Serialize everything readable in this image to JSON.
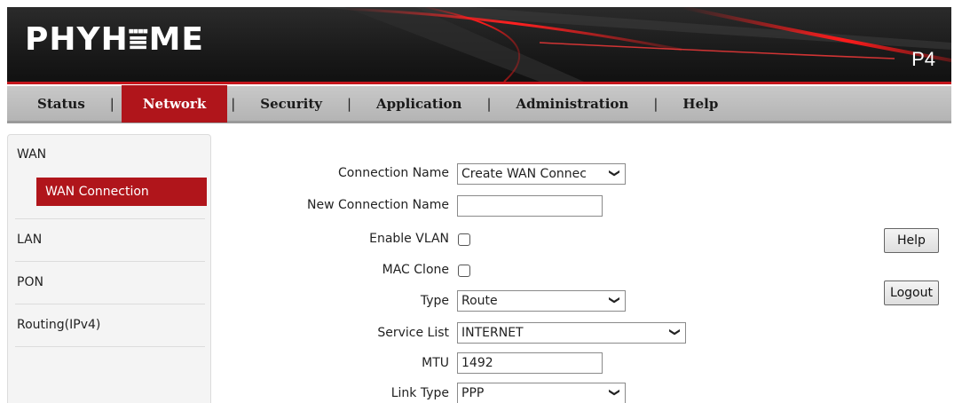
{
  "header": {
    "logo": "PHYH⩸ME",
    "model": "P4"
  },
  "menu": {
    "items": [
      {
        "label": "Status"
      },
      {
        "label": "Network",
        "active": true
      },
      {
        "label": "Security"
      },
      {
        "label": "Application"
      },
      {
        "label": "Administration"
      },
      {
        "label": "Help"
      }
    ],
    "separator": "|"
  },
  "sidebar": {
    "wan": "WAN",
    "wan_connection": "WAN Connection",
    "lan": "LAN",
    "pon": "PON",
    "routing": "Routing(IPv4)"
  },
  "form": {
    "connection_name": {
      "label": "Connection Name",
      "value": "Create WAN Connec"
    },
    "new_connection_name": {
      "label": "New Connection Name",
      "value": ""
    },
    "enable_vlan": {
      "label": "Enable VLAN",
      "checked": false
    },
    "mac_clone": {
      "label": "MAC Clone",
      "checked": false
    },
    "type": {
      "label": "Type",
      "value": "Route"
    },
    "service_list": {
      "label": "Service List",
      "value": "INTERNET"
    },
    "mtu": {
      "label": "MTU",
      "value": "1492"
    },
    "link_type": {
      "label": "Link Type",
      "value": "PPP"
    }
  },
  "buttons": {
    "help": "Help",
    "logout": "Logout"
  },
  "colors": {
    "accent": "#b0151b",
    "menubar": "#c0c0c0",
    "banner": "#1a1a1a"
  }
}
